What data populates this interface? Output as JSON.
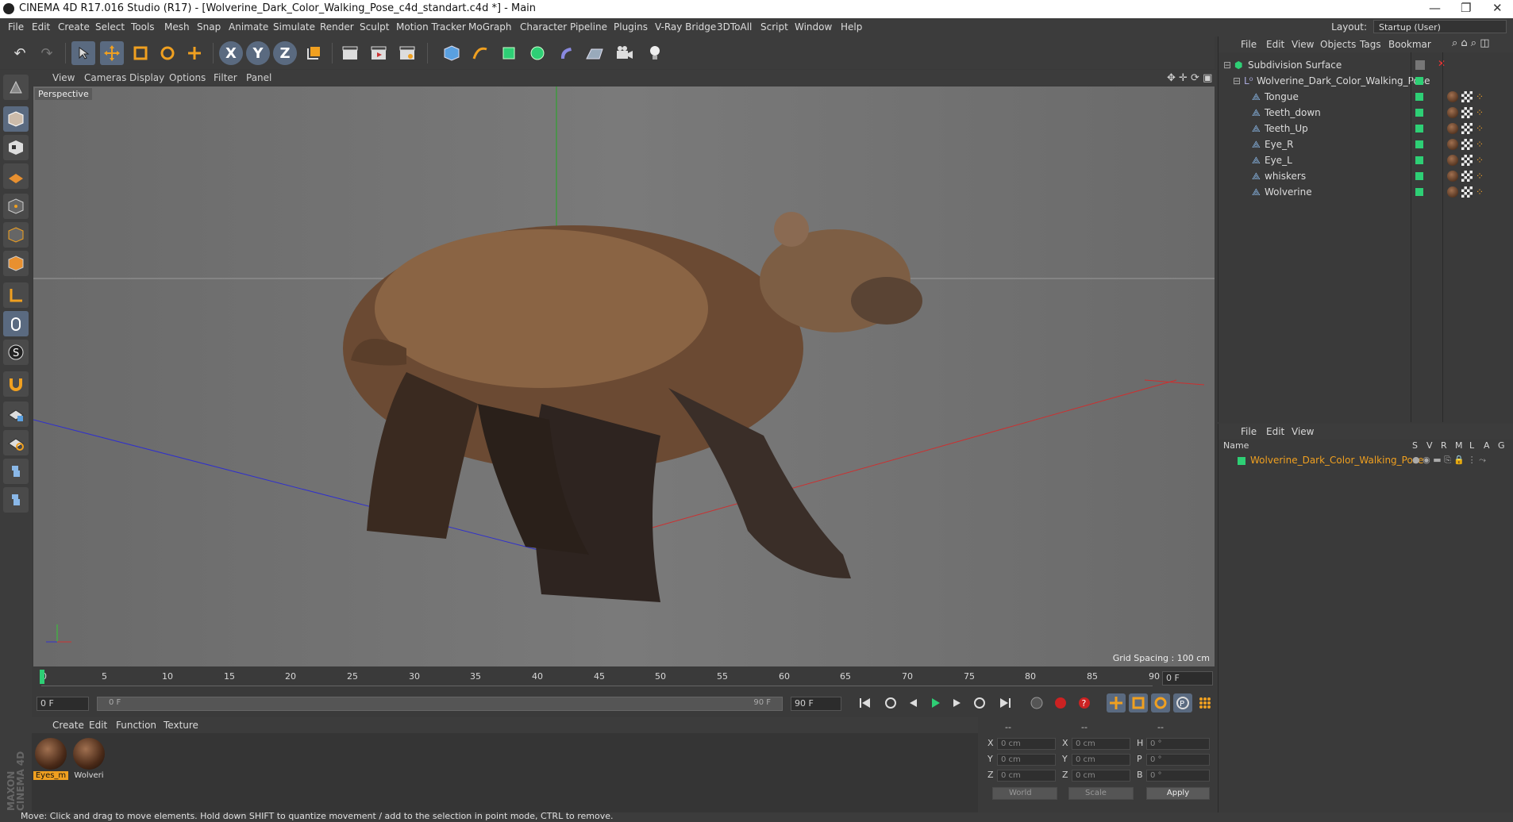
{
  "window": {
    "title": "CINEMA 4D R17.016 Studio (R17) - [Wolverine_Dark_Color_Walking_Pose_c4d_standart.c4d *] - Main",
    "min_glyph": "—",
    "restore_glyph": "❐",
    "close_glyph": "✕"
  },
  "menu": {
    "items": [
      "File",
      "Edit",
      "Create",
      "Select",
      "Tools",
      "Mesh",
      "Snap",
      "Animate",
      "Simulate",
      "Render",
      "Sculpt",
      "Motion Tracker",
      "MoGraph",
      "Character",
      "Pipeline",
      "Plugins",
      "V-Ray Bridge",
      "3DToAll",
      "Script",
      "Window",
      "Help"
    ],
    "layout_label": "Layout:",
    "layout_value": "Startup (User)"
  },
  "toolbar": {
    "undo": "↶",
    "redo": "↷",
    "axis_x": "X",
    "axis_y": "Y",
    "axis_z": "Z"
  },
  "viewport": {
    "menu": [
      "View",
      "Cameras",
      "Display",
      "Options",
      "Filter",
      "Panel"
    ],
    "camera_label": "Perspective",
    "grid_spacing": "Grid Spacing : 100 cm"
  },
  "timeline": {
    "ticks": [
      "0",
      "5",
      "10",
      "15",
      "20",
      "25",
      "30",
      "35",
      "40",
      "45",
      "50",
      "55",
      "60",
      "65",
      "70",
      "75",
      "80",
      "85",
      "90"
    ],
    "current_frame": "0 F",
    "start_frame": "0 F",
    "range_start": "0 F",
    "range_end": "90 F",
    "end_frame": "90 F",
    "frame_readout": "0 F"
  },
  "materials": {
    "menu": [
      "Create",
      "Edit",
      "Function",
      "Texture"
    ],
    "items": [
      {
        "label": "Eyes_m",
        "selected": true
      },
      {
        "label": "Wolveri",
        "selected": false
      }
    ],
    "brand_top": "MAXON",
    "brand_bottom": "CINEMA 4D"
  },
  "coordinates": {
    "header": [
      "--",
      "--",
      "--"
    ],
    "rows": [
      {
        "l1": "X",
        "v1": "0 cm",
        "l2": "X",
        "v2": "0 cm",
        "l3": "H",
        "v3": "0 °"
      },
      {
        "l1": "Y",
        "v1": "0 cm",
        "l2": "Y",
        "v2": "0 cm",
        "l3": "P",
        "v3": "0 °"
      },
      {
        "l1": "Z",
        "v1": "0 cm",
        "l2": "Z",
        "v2": "0 cm",
        "l3": "B",
        "v3": "0 °"
      }
    ],
    "world": "World",
    "scale": "Scale",
    "apply": "Apply"
  },
  "object_manager": {
    "menu": [
      "File",
      "Edit",
      "View",
      "Objects",
      "Tags",
      "Bookmar"
    ],
    "root": "Subdivision Surface",
    "group": "Wolverine_Dark_Color_Walking_Pose",
    "children": [
      "Tongue",
      "Teeth_down",
      "Teeth_Up",
      "Eye_R",
      "Eye_L",
      "whiskers",
      "Wolverine"
    ]
  },
  "layer_manager": {
    "menu": [
      "File",
      "Edit",
      "View"
    ],
    "columns": [
      "Name",
      "S",
      "V",
      "R",
      "M",
      "L",
      "A",
      "G"
    ],
    "item": "Wolverine_Dark_Color_Walking_Pose"
  },
  "status": "Move: Click and drag to move elements. Hold down SHIFT to quantize movement / add to the selection in point mode, CTRL to remove."
}
